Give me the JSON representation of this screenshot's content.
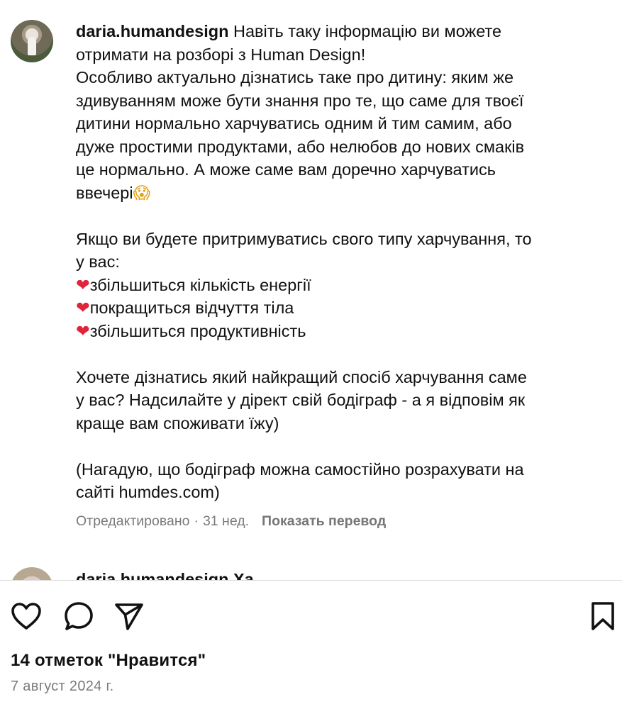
{
  "comment": {
    "username": "daria.humandesign",
    "lines_intro": " Навіть таку інформацію ви можете\nотримати на розборі з Human Design!\nОсобливо актуально дізнатись таке про дитину: яким же\nздивуванням може бути знання про те, що саме для твоєї\nдитини нормально харчуватись одним й тим самим, або\nдуже простими продуктами, або нелюбов до нових смаків\nце нормально. А може саме вам доречно харчуватись\nввечері",
    "intro_emoji": "😱",
    "para2_lead": "Якщо ви будете притримуватись свого типу харчування, то\nу вас:",
    "heart_emoji": "❤",
    "benefits": [
      "збільшиться кількість енергії",
      "покращиться відчуття тіла",
      "збільшиться продуктивність"
    ],
    "para3": "Хочете дізнатись який найкращий спосіб харчування саме\nу вас? Надсилайте у дірект свій бодіграф - а я відповім як\nкраще вам споживати їжу)",
    "para4": "(Нагадую, що бодіграф можна самостійно розрахувати на\nсайті humdes.com)",
    "edited": "Отредактировано",
    "separator": "·",
    "age": "31 нед.",
    "translate": "Показать перевод"
  },
  "next_comment": {
    "partial_text": "daria.humandesign Ха"
  },
  "actions": {
    "like_icon": "heart-outline-icon",
    "comment_icon": "comment-bubble-icon",
    "share_icon": "paper-plane-icon",
    "save_icon": "bookmark-icon"
  },
  "likes_text": "14 отметок \"Нравится\"",
  "date_text": "7 август 2024 г."
}
